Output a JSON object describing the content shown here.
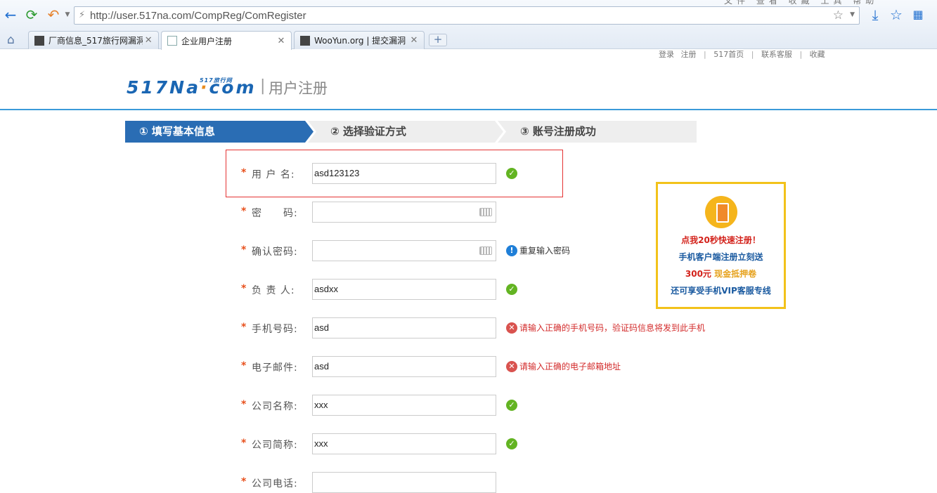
{
  "browser": {
    "url": "http://user.517na.com/CompReg/ComRegister",
    "top_menu": "文件 查看 收藏 工具 帮助",
    "tabs": [
      {
        "label": "厂商信息_517旅行网漏洞",
        "active": false
      },
      {
        "label": "企业用户注册",
        "active": true
      },
      {
        "label": "WooYun.org | 提交漏洞",
        "active": false
      }
    ],
    "new_tab": "+"
  },
  "top_links": [
    "登录",
    "注册",
    "517首页",
    "联系客服",
    "收藏"
  ],
  "header": {
    "logo_main": "517Na",
    "logo_dot": "·",
    "logo_com": "com",
    "logo_sub": "517旅行网",
    "separator": "|",
    "title": "用户注册"
  },
  "steps": [
    {
      "label": "① 填写基本信息",
      "active": true
    },
    {
      "label": "② 选择验证方式",
      "active": false
    },
    {
      "label": "③ 账号注册成功",
      "active": false
    }
  ],
  "form": {
    "required_mark": "*",
    "fields": [
      {
        "label": "用 户 名:",
        "value": "asd123123",
        "status": "ok",
        "message": ""
      },
      {
        "label": "密　　码:",
        "value": "",
        "status": "",
        "message": ""
      },
      {
        "label": "确认密码:",
        "value": "",
        "status": "info",
        "message": "重复输入密码"
      },
      {
        "label": "负 责 人:",
        "value": "asdxx",
        "status": "ok",
        "message": ""
      },
      {
        "label": "手机号码:",
        "value": "asd",
        "status": "err",
        "message": "请输入正确的手机号码，验证码信息将发到此手机"
      },
      {
        "label": "电子邮件:",
        "value": "asd",
        "status": "err",
        "message": "请输入正确的电子邮箱地址"
      },
      {
        "label": "公司名称:",
        "value": "xxx",
        "status": "ok",
        "message": ""
      },
      {
        "label": "公司简称:",
        "value": "xxx",
        "status": "ok",
        "message": ""
      },
      {
        "label": "公司电话:",
        "value": "",
        "status": "",
        "message": ""
      }
    ]
  },
  "promo": {
    "line1": "点我20秒快速注册！",
    "line2": "手机客户端注册立刻送",
    "line3_amount": "300元",
    "line3_text": " 现金抵押卷",
    "line4": "还可享受手机VIP客服专线"
  },
  "colors": {
    "accent": "#2a6db4",
    "header_line": "#3a9ad9",
    "error": "#d32c2c",
    "ok": "#63b422",
    "promo_border": "#f2c21a"
  }
}
